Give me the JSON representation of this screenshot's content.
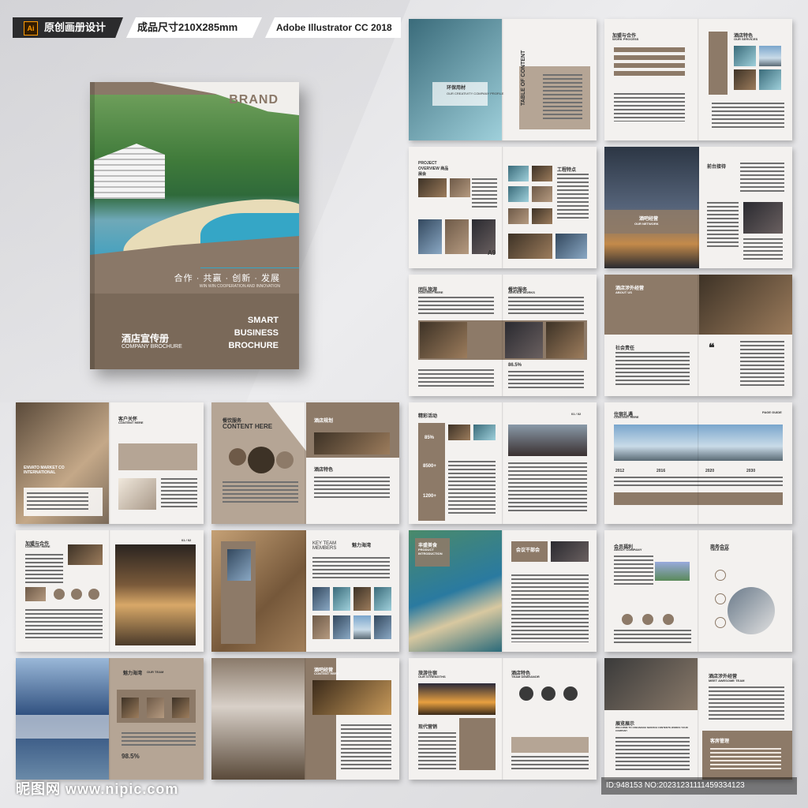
{
  "header": {
    "ai_badge": "Ai",
    "tag_design": "原创画册设计",
    "tag_size": "成品尺寸210X285mm",
    "tag_software": "Adobe Illustrator CC 2018"
  },
  "cover": {
    "brand": "BRAND",
    "slogan_cn": "合作 · 共赢 · 创新 · 发展",
    "slogan_en": "WIN WIN COOPERATION AND INNOVATION",
    "title_cn": "酒店宣传册",
    "title_en": "COMPANY BROCHURE",
    "smart_lines": [
      "SMART",
      "BUSINESS",
      "BROCHURE"
    ]
  },
  "spreads": {
    "s1": {
      "left_title": "环保用材",
      "left_sub": "OUR CREATIVITY COMPANY PROFILE",
      "toc": "TABLE OF CONTENT"
    },
    "s2": {
      "left_title": "加盟与合作",
      "left_sub": "WORK PROCESS",
      "right_title": "酒店特色",
      "right_sub": "OUR SERVICES"
    },
    "s3": {
      "left_title": "PROJECT OVERVIEW 商品展会",
      "right_title": "工程特点",
      "badge": "A9"
    },
    "s4": {
      "center_title": "酒吧经营",
      "center_sub": "OUR NETWORK",
      "right_title": "前台接待"
    },
    "s5": {
      "left_title": "团队旅游",
      "left_sub": "CONTENT HERE",
      "right_title": "餐饮服务",
      "right_sub": "SERVICE WORKS",
      "stat": "86.5%"
    },
    "s6": {
      "left_title": "酒店涉外经营",
      "left_sub": "ABOUT US",
      "quote": "❝",
      "left_title2": "社会责任"
    },
    "s7": {
      "left_title": "ENVATO MARKET CO INTERNATIONAL",
      "right_title": "客户关怀",
      "right_sub": "CONTENT HERE"
    },
    "s8": {
      "left_title": "餐饮服务",
      "left_sub": "CONTENT HERE",
      "right_title": "酒店规划",
      "right_title2": "酒店特色"
    },
    "s9": {
      "left_title": "精彩活动",
      "stat1": "85%",
      "stat2": "8500+",
      "stat3": "1200+",
      "page": "01 / 02"
    },
    "s10": {
      "left_title": "住宿礼遇",
      "left_sub": "CONTENT HERE",
      "years": [
        "2012",
        "2016",
        "2020",
        "2030"
      ],
      "page_label": "PAGE GUIDE"
    },
    "s11": {
      "left_title": "加盟与合作",
      "left_sub": "CONTENT HERE",
      "page": "01 / 02"
    },
    "s12": {
      "left_title": "KEY TEAM MEMBERS",
      "left_title_cn": "魅力海湾"
    },
    "s13": {
      "left_title": "丰盛美食",
      "left_sub": "PRODUCT INTRODUCTION",
      "right_title": "会议干部会"
    },
    "s14": {
      "left_title": "会员福利",
      "left_sub": "ABOUT COMPANY",
      "right_title": "商务会议",
      "right_sub": "TIELE HERE"
    },
    "s15": {
      "left_title": "魅力海湾",
      "left_sub": "OUR TEAM",
      "stat": "98.5%"
    },
    "s16": {
      "left_title": "酒吧经营",
      "left_sub": "CONTENT HERE"
    },
    "s17": {
      "left_title": "旅游住宿",
      "left_sub": "OUR STRENGTHS",
      "left_title2": "现代营销",
      "right_title": "酒店特色",
      "right_sub": "TEAM DEMEANOR"
    },
    "s18": {
      "left_title": "展览展示",
      "left_sub": "WELCOME TO CREAMAKE SERVICE CONTENTS WORKS YOUR COMPANY",
      "right_title": "酒店涉外经营",
      "right_sub": "MEET AWESOME TEAM",
      "right_title2": "客房管理"
    }
  },
  "footer": {
    "watermark": "昵图网 www.nipic.com",
    "id_text": "ID:948153 NO:20231231111459334123"
  }
}
